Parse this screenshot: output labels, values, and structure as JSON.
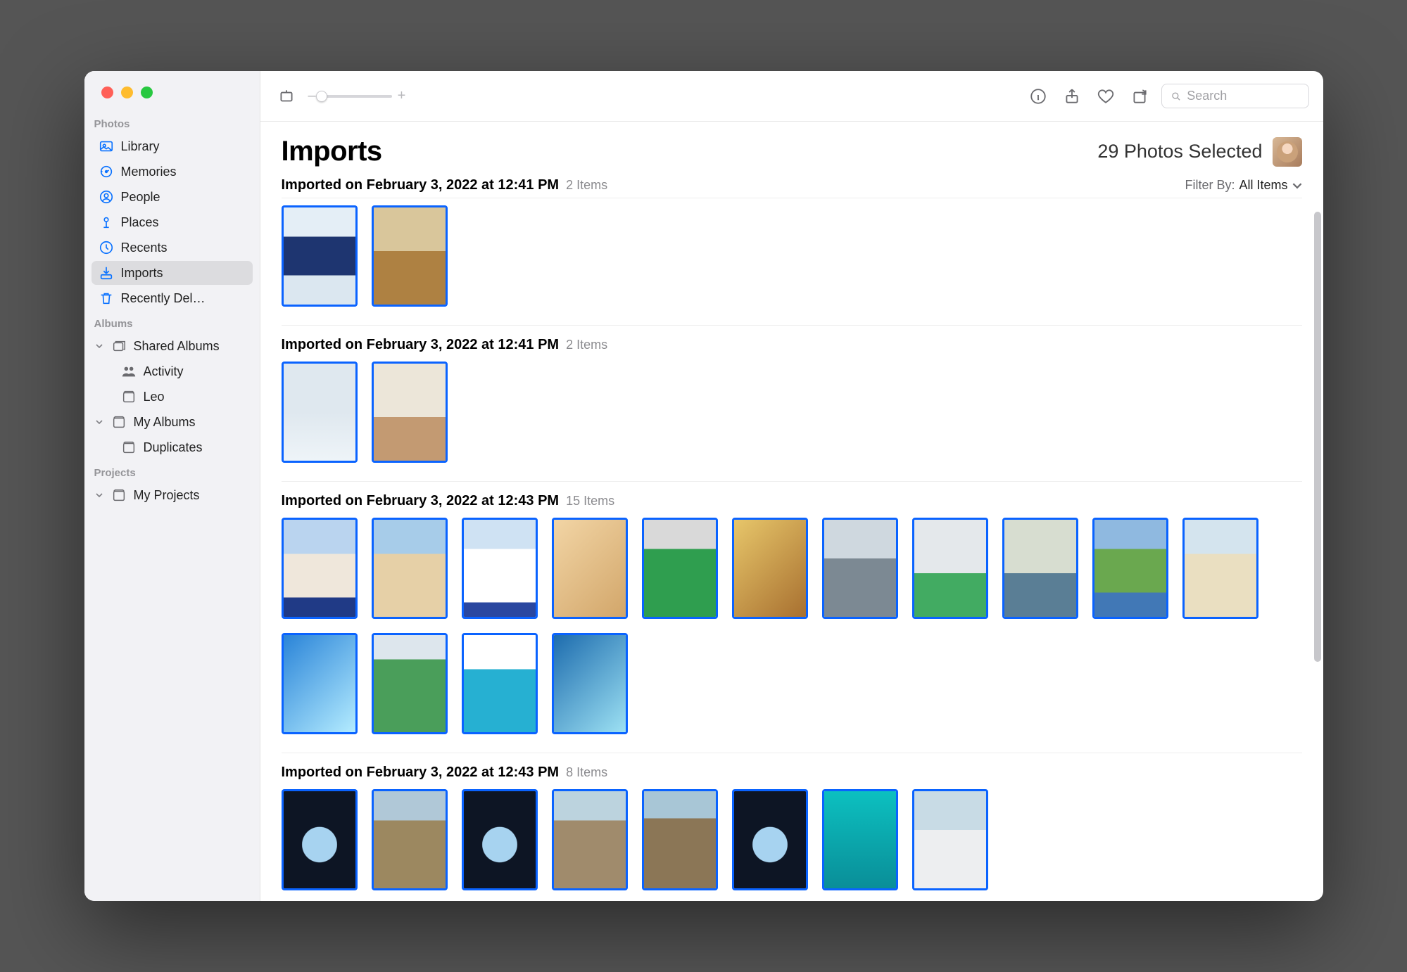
{
  "sidebar": {
    "sections": {
      "photos": {
        "label": "Photos",
        "items": [
          {
            "label": "Library"
          },
          {
            "label": "Memories"
          },
          {
            "label": "People"
          },
          {
            "label": "Places"
          },
          {
            "label": "Recents"
          },
          {
            "label": "Imports"
          },
          {
            "label": "Recently Del…"
          }
        ]
      },
      "albums": {
        "label": "Albums",
        "shared": {
          "label": "Shared Albums",
          "children": [
            {
              "label": "Activity"
            },
            {
              "label": "Leo"
            }
          ]
        },
        "my": {
          "label": "My Albums",
          "children": [
            {
              "label": "Duplicates"
            }
          ]
        }
      },
      "projects": {
        "label": "Projects",
        "my": {
          "label": "My Projects"
        }
      }
    }
  },
  "toolbar": {
    "zoom_minus": "–",
    "zoom_plus": "+",
    "search_placeholder": "Search"
  },
  "header": {
    "title": "Imports",
    "selection": "29 Photos Selected"
  },
  "filter": {
    "label": "Filter By:",
    "value": "All Items"
  },
  "import_sections": [
    {
      "title": "Imported on February 3, 2022 at 12:41 PM",
      "count": "2 Items",
      "photos": [
        "p-blue-winter",
        "p-indoor"
      ]
    },
    {
      "title": "Imported on February 3, 2022 at 12:41 PM",
      "count": "2 Items",
      "photos": [
        "p-snow",
        "p-toy"
      ]
    },
    {
      "title": "Imported on February 3, 2022 at 12:43 PM",
      "count": "15 Items",
      "photos": [
        "p-dome",
        "p-beach",
        "p-white-blue",
        "p-kids",
        "p-golf",
        "p-toys2",
        "p-skate",
        "p-putt",
        "p-sea",
        "p-lake",
        "p-sand",
        "p-ocean",
        "p-green",
        "p-pool",
        "p-wave"
      ]
    },
    {
      "title": "Imported on February 3, 2022 at 12:43 PM",
      "count": "8 Items",
      "photos": [
        "p-plane",
        "p-rocks",
        "p-plane2",
        "p-pebbles",
        "p-cliff",
        "p-plane3",
        "p-turquoise",
        "p-boat"
      ]
    }
  ]
}
